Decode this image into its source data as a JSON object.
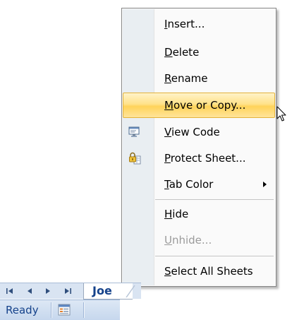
{
  "context_menu": {
    "items": [
      {
        "pre": "",
        "key": "I",
        "post": "nsert...",
        "state": "normal"
      },
      {
        "pre": "",
        "key": "D",
        "post": "elete",
        "state": "normal"
      },
      {
        "pre": "",
        "key": "R",
        "post": "ename",
        "state": "normal"
      },
      {
        "pre": "",
        "key": "M",
        "post": "ove or Copy...",
        "state": "highlighted"
      },
      {
        "pre": "",
        "key": "V",
        "post": "iew Code",
        "state": "normal",
        "icon": "view-code-icon"
      },
      {
        "pre": "",
        "key": "P",
        "post": "rotect Sheet...",
        "state": "normal",
        "icon": "protect-sheet-icon"
      },
      {
        "pre": "",
        "key": "T",
        "post": "ab Color",
        "state": "normal",
        "submenu": true
      },
      {
        "pre": "",
        "key": "H",
        "post": "ide",
        "state": "normal"
      },
      {
        "pre": "",
        "key": "U",
        "post": "nhide...",
        "state": "disabled"
      },
      {
        "pre": "",
        "key": "S",
        "post": "elect All Sheets",
        "state": "normal"
      }
    ],
    "colors": {
      "highlight_top": "#fff3c9",
      "highlight_bottom": "#ffd35a",
      "highlight_border": "#e3b23a",
      "icon_column": "#e9eef2",
      "disabled_text": "#9b9b9b"
    }
  },
  "sheet_tabs": {
    "active_tab": "Joe",
    "nav_icons": [
      "first-sheet-icon",
      "previous-sheet-icon",
      "next-sheet-icon",
      "last-sheet-icon"
    ]
  },
  "status_bar": {
    "status": "Ready",
    "macro_icon": "record-macro-icon"
  }
}
